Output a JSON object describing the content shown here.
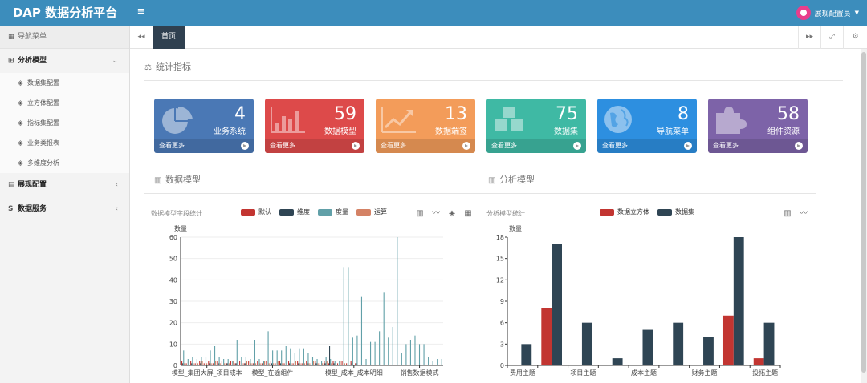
{
  "app": {
    "title": "DAP 数据分析平台",
    "menu_toggle": "≡",
    "user": "展现配置员"
  },
  "sidebar": {
    "header": "导航菜单",
    "groups": [
      {
        "label": "分析模型",
        "chev": "⌄"
      },
      {
        "label": "展现配置",
        "chev": "‹"
      },
      {
        "label": "数据服务",
        "chev": "‹"
      }
    ],
    "subitems": [
      {
        "label": "数据集配置"
      },
      {
        "label": "立方体配置"
      },
      {
        "label": "指标集配置"
      },
      {
        "label": "业务类报表"
      },
      {
        "label": "多维度分析"
      }
    ]
  },
  "tabs": {
    "prev": "◂◂",
    "home": "首页",
    "next": "▸▸",
    "fullscreen": "⤢",
    "settings": "⚙"
  },
  "sections": {
    "stats": "统计指标",
    "data_model": "数据模型",
    "analysis_model": "分析模型"
  },
  "cards": [
    {
      "num": "4",
      "label": "业务系统",
      "more": "查看更多",
      "color": "#4a78b5",
      "icon": "pie-chart-icon"
    },
    {
      "num": "59",
      "label": "数据模型",
      "more": "查看更多",
      "color": "#dd4a4a",
      "icon": "bar-chart-icon"
    },
    {
      "num": "13",
      "label": "数据端签",
      "more": "查看更多",
      "color": "#f39c5a",
      "icon": "line-chart-icon"
    },
    {
      "num": "75",
      "label": "数据集",
      "more": "查看更多",
      "color": "#3fb9a4",
      "icon": "cubes-icon"
    },
    {
      "num": "8",
      "label": "导航菜单",
      "more": "查看更多",
      "color": "#2d8fe0",
      "icon": "globe-icon"
    },
    {
      "num": "58",
      "label": "组件资源",
      "more": "查看更多",
      "color": "#7d63a8",
      "icon": "puzzle-icon"
    }
  ],
  "chart_data": [
    {
      "type": "bar",
      "title": "数据模型字段统计",
      "ylabel": "数量",
      "ylim": [
        0,
        60
      ],
      "yticks": [
        0,
        10,
        20,
        30,
        40,
        50,
        60
      ],
      "xtick_labels": [
        "模型_集团大屏_项目成本",
        "模型_在途组件",
        "模型_成本_成本明细",
        "销售数据模式"
      ],
      "legend": [
        "默认",
        "维度",
        "度量",
        "运算"
      ],
      "series_colors": [
        "#c23531",
        "#2f4554",
        "#61a0a8",
        "#d48265"
      ],
      "series": [
        {
          "name": "默认",
          "values": [
            2,
            1,
            2,
            1,
            2,
            1,
            2,
            1,
            2,
            2,
            1,
            2,
            1,
            2,
            1,
            2,
            1,
            2,
            1,
            2,
            2,
            1,
            2,
            1,
            2,
            1,
            2,
            1,
            2,
            1,
            2,
            1,
            2,
            1,
            2,
            1,
            2,
            1,
            2,
            1,
            0,
            0,
            0,
            0,
            0,
            0,
            0,
            0,
            0,
            0,
            0,
            0,
            0,
            0,
            0,
            0,
            0,
            0,
            0
          ]
        },
        {
          "name": "维度",
          "values": [
            1,
            0,
            1,
            0,
            1,
            0,
            1,
            0,
            1,
            0,
            1,
            0,
            1,
            0,
            1,
            0,
            1,
            0,
            1,
            0,
            1,
            0,
            1,
            0,
            1,
            0,
            1,
            0,
            1,
            0,
            1,
            0,
            1,
            9,
            1,
            0,
            0,
            0,
            1,
            1,
            0,
            0,
            0,
            0,
            0,
            0,
            0,
            0,
            0,
            0,
            0,
            0,
            0,
            0,
            0,
            0,
            0,
            0,
            0
          ]
        },
        {
          "name": "度量",
          "values": [
            7,
            3,
            4,
            3,
            4,
            4,
            7,
            9,
            4,
            3,
            3,
            2,
            12,
            4,
            4,
            3,
            12,
            3,
            2,
            16,
            7,
            7,
            7,
            9,
            8,
            6,
            8,
            8,
            6,
            4,
            3,
            2,
            4,
            3,
            2,
            2,
            46,
            46,
            13,
            14,
            32,
            3,
            11,
            11,
            16,
            34,
            13,
            18,
            60,
            6,
            10,
            12,
            14,
            10,
            10,
            4,
            2,
            3,
            3
          ]
        },
        {
          "name": "运算",
          "values": [
            1,
            2,
            1,
            1,
            2,
            1,
            1,
            2,
            1,
            1,
            1,
            2,
            1,
            1,
            2,
            1,
            1,
            1,
            2,
            1,
            1,
            2,
            1,
            1,
            1,
            2,
            1,
            1,
            1,
            2,
            1,
            1,
            2,
            1,
            1,
            2,
            1,
            0,
            0,
            0,
            0,
            0,
            0,
            0,
            0,
            0,
            0,
            0,
            0,
            0,
            0,
            0,
            0,
            0,
            0,
            0,
            0,
            0,
            0
          ]
        }
      ],
      "grid": false
    },
    {
      "type": "bar",
      "title": "分析模型统计",
      "ylabel": "数量",
      "ylim": [
        0,
        18
      ],
      "yticks": [
        0,
        3,
        6,
        9,
        12,
        15,
        18
      ],
      "categories": [
        "费用主题",
        "",
        "项目主题",
        "",
        "成本主题",
        "",
        "财务主题",
        "",
        "投拓主题"
      ],
      "xtick_labels": [
        "费用主题",
        "项目主题",
        "成本主题",
        "财务主题",
        "投拓主题"
      ],
      "legend": [
        "数据立方体",
        "数据集"
      ],
      "series_colors": [
        "#c23531",
        "#2f4554"
      ],
      "series": [
        {
          "name": "数据立方体",
          "values": [
            0,
            8,
            0,
            0,
            0,
            0,
            0,
            7,
            1
          ]
        },
        {
          "name": "数据集",
          "values": [
            3,
            17,
            6,
            1,
            5,
            6,
            4,
            18,
            6
          ]
        }
      ],
      "grid": false
    }
  ],
  "toolbox_left": [
    "bar-view-icon",
    "line-view-icon",
    "stack-icon",
    "tiled-icon"
  ],
  "toolbox_right": [
    "bar-view-icon",
    "line-view-icon"
  ]
}
